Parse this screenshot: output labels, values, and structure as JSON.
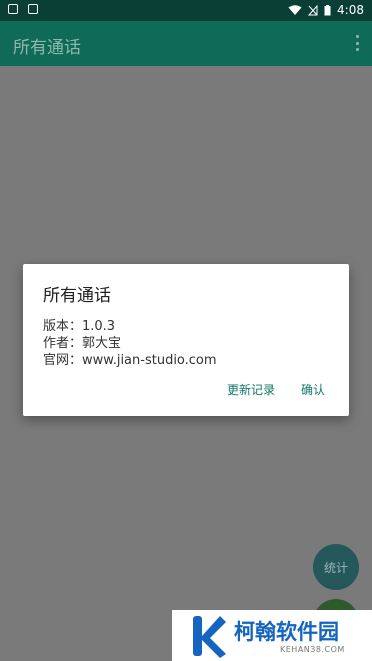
{
  "status_bar": {
    "time": "4:08"
  },
  "app_bar": {
    "title": "所有通话"
  },
  "dialog": {
    "title": "所有通话",
    "version_line": "版本：1.0.3",
    "author_line": "作者：郭大宝",
    "website_line": "官网：www.jian-studio.com",
    "changelog_button": "更新记录",
    "confirm_button": "确认"
  },
  "fab": {
    "stats_label": "统计"
  },
  "watermark": {
    "brand": "柯翰软件园",
    "domain": "KEHAN38.COM"
  }
}
